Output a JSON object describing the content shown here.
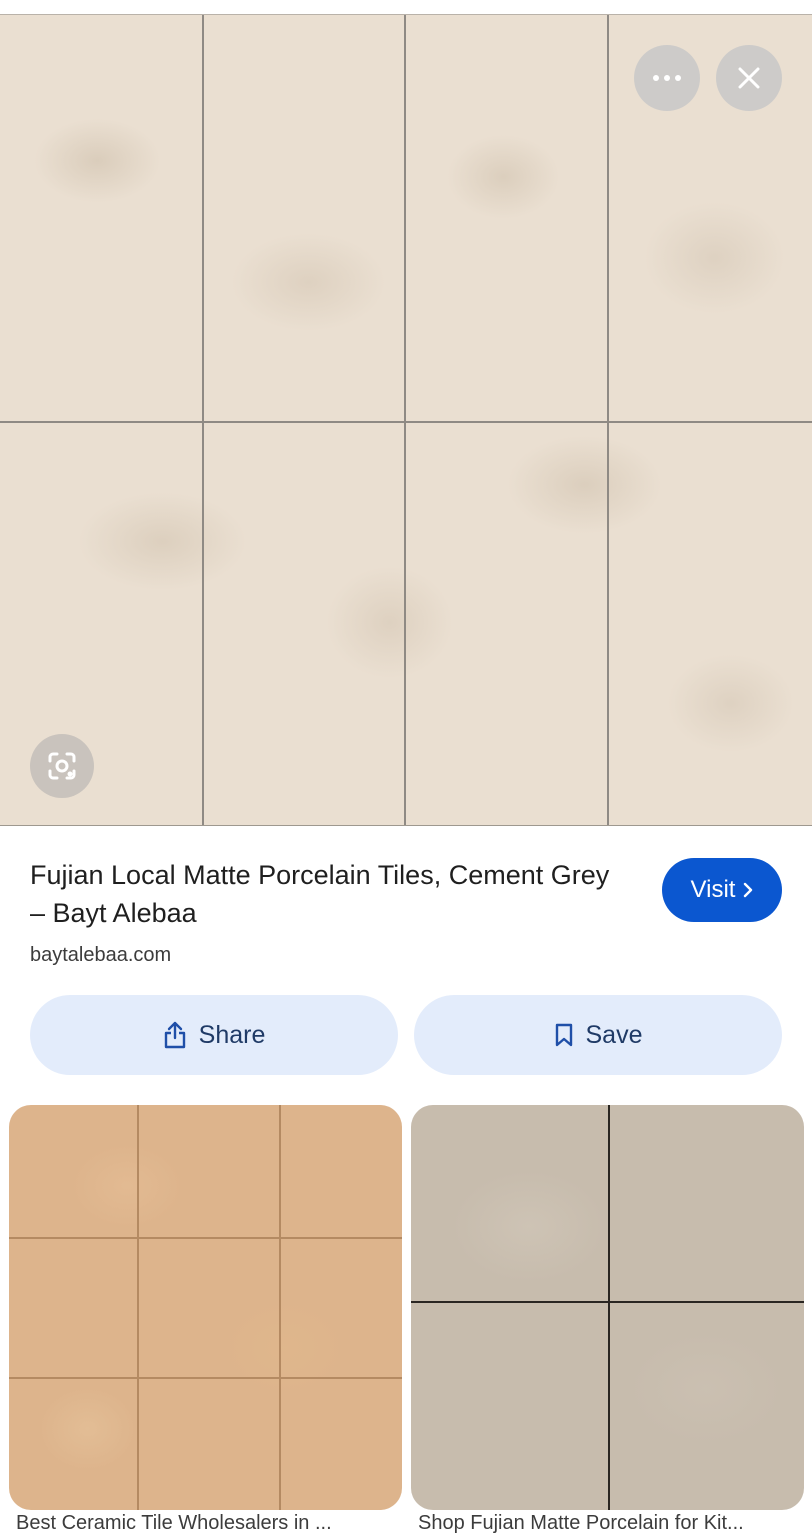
{
  "hero": {
    "alt": "Fujian Local Matte Porcelain Tiles, Cement Grey",
    "more_button_icon": "more-horizontal-icon",
    "close_button_icon": "close-icon",
    "lens_button_icon": "google-lens-icon"
  },
  "result": {
    "title": "Fujian Local Matte Porcelain Tiles, Cement Grey – Bayt Alebaa",
    "domain": "baytalebaa.com",
    "visit_label": "Visit"
  },
  "actions": {
    "share_label": "Share",
    "save_label": "Save"
  },
  "related": [
    {
      "caption": "Best Ceramic Tile Wholesalers in ..."
    },
    {
      "caption": "Shop Fujian Matte Porcelain for Kit..."
    }
  ],
  "colors": {
    "accent": "#0b57d0",
    "pill_bg": "#e3ecfb",
    "tile_beige": "#eadfd1"
  }
}
